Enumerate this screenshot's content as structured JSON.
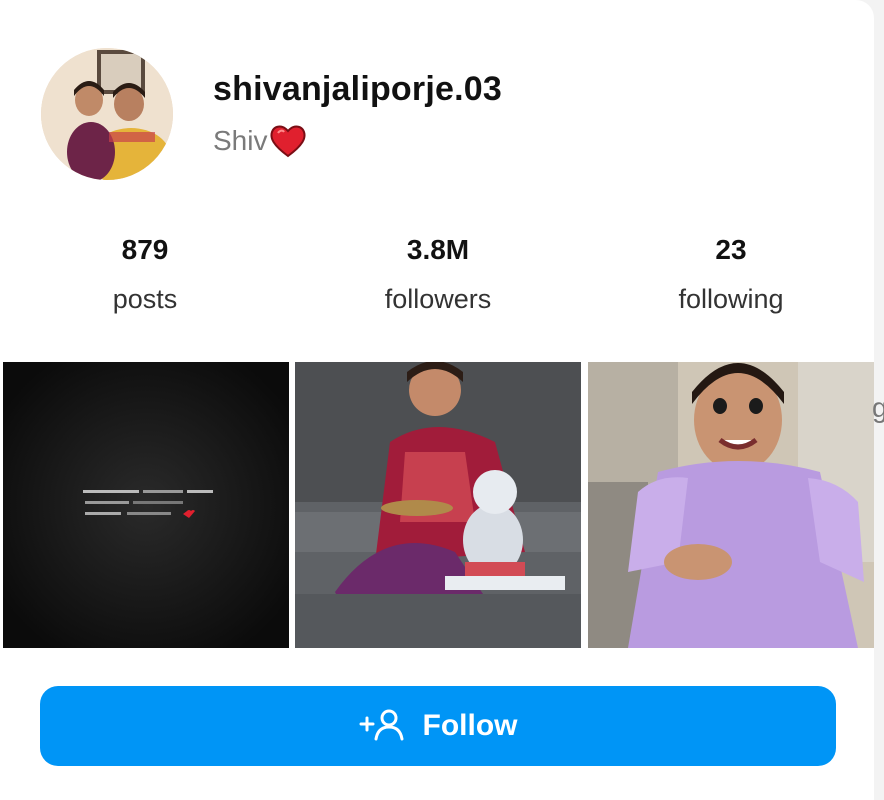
{
  "profile": {
    "username": "shivanjaliporje.03",
    "full_name": "Shiv",
    "name_emoji": "heart-icon",
    "avatar": "profile-photo"
  },
  "stats": [
    {
      "value": "879",
      "label": "posts"
    },
    {
      "value": "3.8M",
      "label": "followers"
    },
    {
      "value": "23",
      "label": "following"
    }
  ],
  "posts": [
    {
      "kind": "text-quote-dark"
    },
    {
      "kind": "photo-ganesha-saree"
    },
    {
      "kind": "photo-girl-purple-dress"
    }
  ],
  "follow_button": {
    "label": "Follow",
    "icon": "add-person-icon",
    "color": "#0095f6"
  },
  "edge_glyph": "g"
}
